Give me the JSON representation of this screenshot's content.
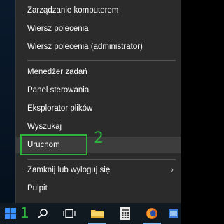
{
  "menu": {
    "items": [
      {
        "label": "Zarządzanie komputerem"
      },
      {
        "label": "Wiersz polecenia"
      },
      {
        "label": "Wiersz polecenia (administrator)"
      },
      {
        "label": "Menedżer zadań"
      },
      {
        "label": "Panel sterowania"
      },
      {
        "label": "Eksplorator plików"
      },
      {
        "label": "Wyszukaj"
      },
      {
        "label": "Uruchom"
      },
      {
        "label": "Zamknij lub wyloguj się"
      },
      {
        "label": "Pulpit"
      }
    ],
    "submenu_arrow": "›"
  },
  "annotations": {
    "step1": "1",
    "step2": "2",
    "color": "#2fb33f"
  },
  "taskbar": {
    "icons": [
      "windows-start-icon",
      "search-icon",
      "task-view-icon",
      "file-explorer-icon",
      "calculator-icon",
      "firefox-icon",
      "app-icon"
    ]
  }
}
